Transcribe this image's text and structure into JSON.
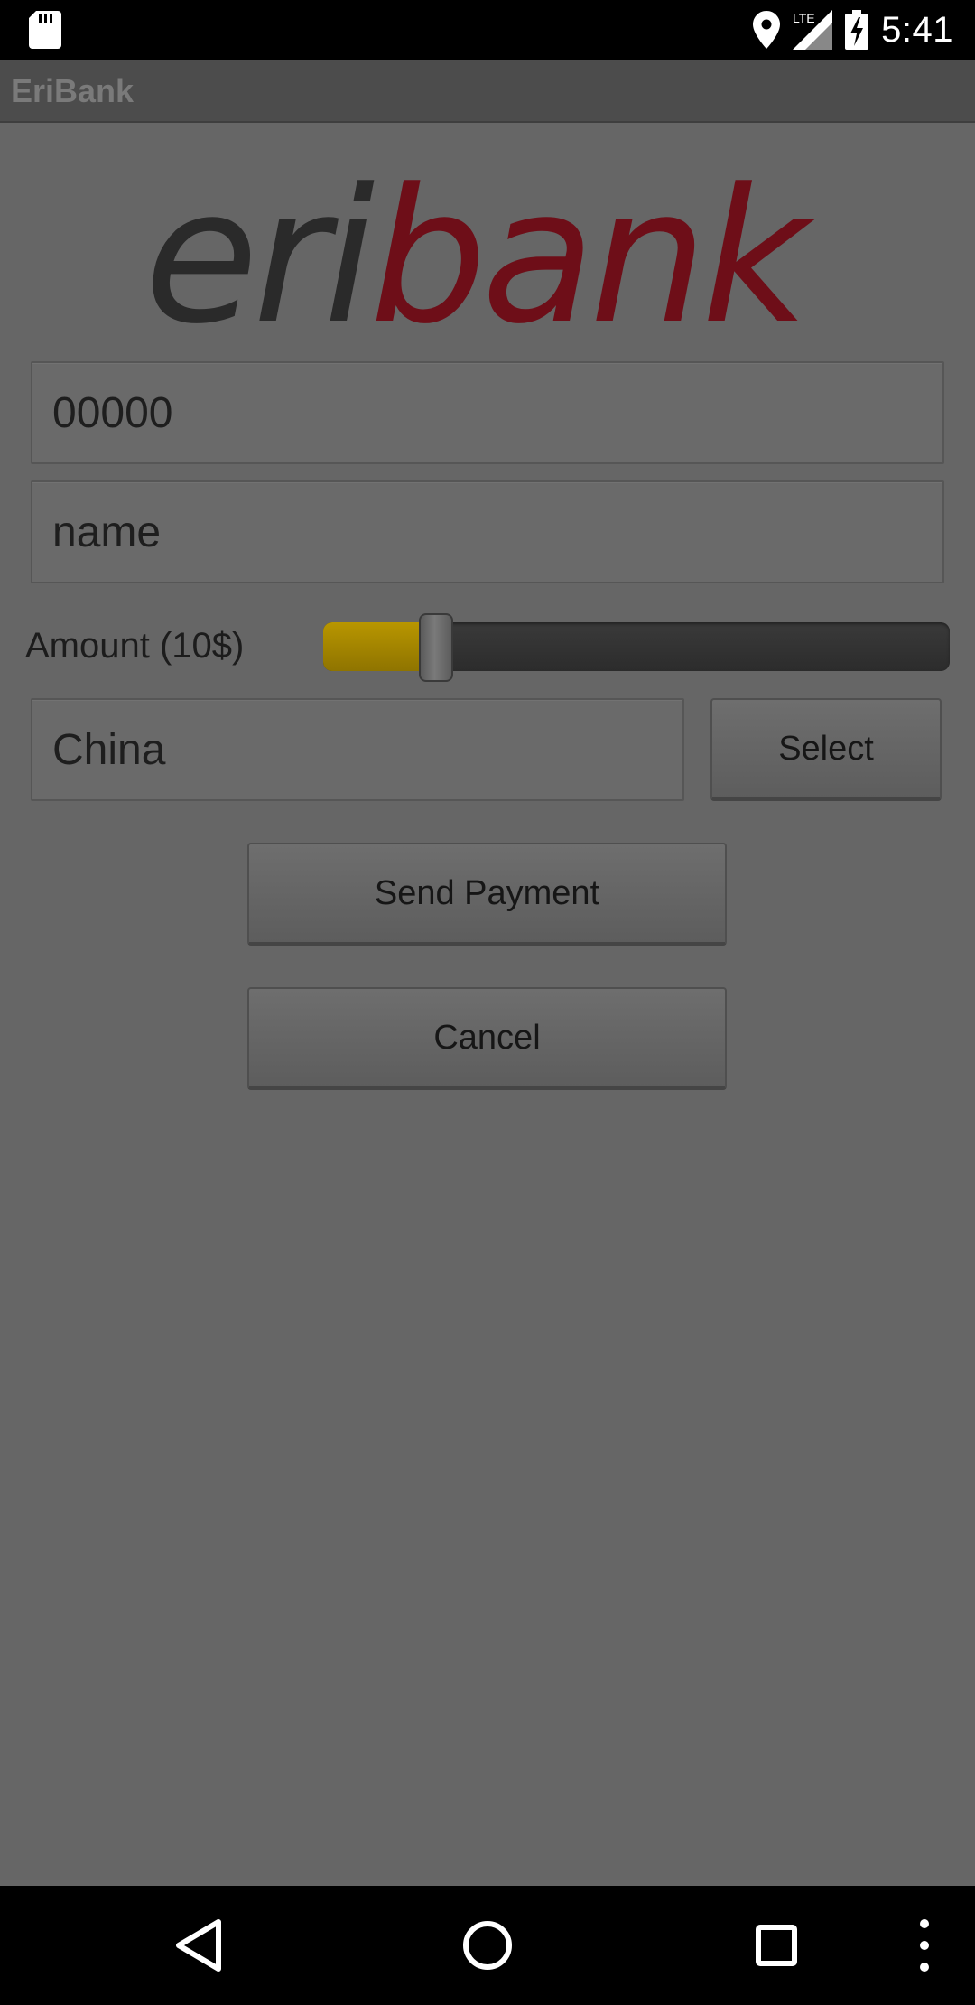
{
  "status_bar": {
    "time": "5:41",
    "network": "LTE",
    "icons": [
      "sd-card-icon",
      "location-icon",
      "lte-signal-icon",
      "battery-charging-icon"
    ]
  },
  "app_bar": {
    "title": "EriBank"
  },
  "logo": {
    "part1": "eri",
    "part2": "bank",
    "colors": {
      "dark": "#2a2a2a",
      "accent": "#6e0e18"
    }
  },
  "form": {
    "account_value": "00000",
    "name_value": "name",
    "amount_label": "Amount (10$)",
    "amount_fraction": 0.1,
    "country_value": "China",
    "select_label": "Select"
  },
  "actions": {
    "send_label": "Send Payment",
    "cancel_label": "Cancel"
  },
  "nav_bar": {
    "icons": [
      "back-icon",
      "home-icon",
      "recents-icon",
      "overflow-menu-icon"
    ]
  },
  "colors": {
    "accent": "#b89600",
    "dim_overlay": "#666666"
  }
}
